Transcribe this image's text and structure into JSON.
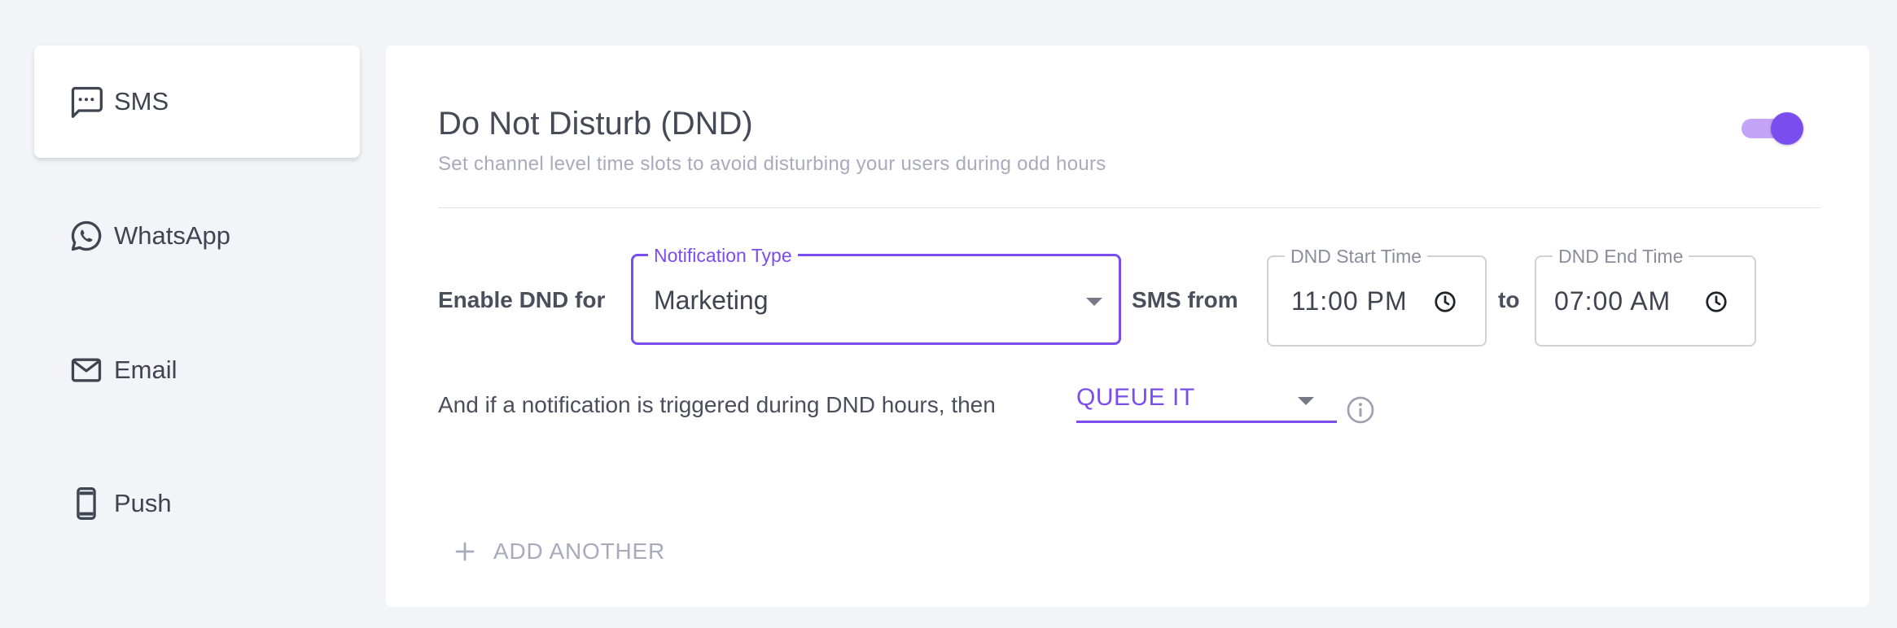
{
  "sidebar": {
    "items": [
      {
        "label": "SMS",
        "icon": "sms-icon",
        "active": true
      },
      {
        "label": "WhatsApp",
        "icon": "whatsapp-icon",
        "active": false
      },
      {
        "label": "Email",
        "icon": "email-icon",
        "active": false
      },
      {
        "label": "Push",
        "icon": "push-icon",
        "active": false
      }
    ]
  },
  "dnd": {
    "title": "Do Not Disturb (DND)",
    "subtitle": "Set channel level time slots to avoid disturbing your users during odd hours",
    "enabled": true,
    "enable_for_label": "Enable DND for",
    "notification_type": {
      "legend": "Notification Type",
      "value": "Marketing"
    },
    "channel_from_label": "SMS from",
    "start_time": {
      "legend": "DND Start Time",
      "value": "11:00 PM"
    },
    "to_label": "to",
    "end_time": {
      "legend": "DND End Time",
      "value": "07:00 AM"
    },
    "triggered_label": "And if a notification is triggered during DND hours, then",
    "action": {
      "value": "QUEUE IT"
    },
    "add_another_label": "ADD ANOTHER"
  },
  "colors": {
    "accent": "#7b4dee",
    "accent_light": "#c3a4f6",
    "background": "#f3f4f8",
    "card": "#ffffff",
    "muted_text": "#a7abbb"
  }
}
